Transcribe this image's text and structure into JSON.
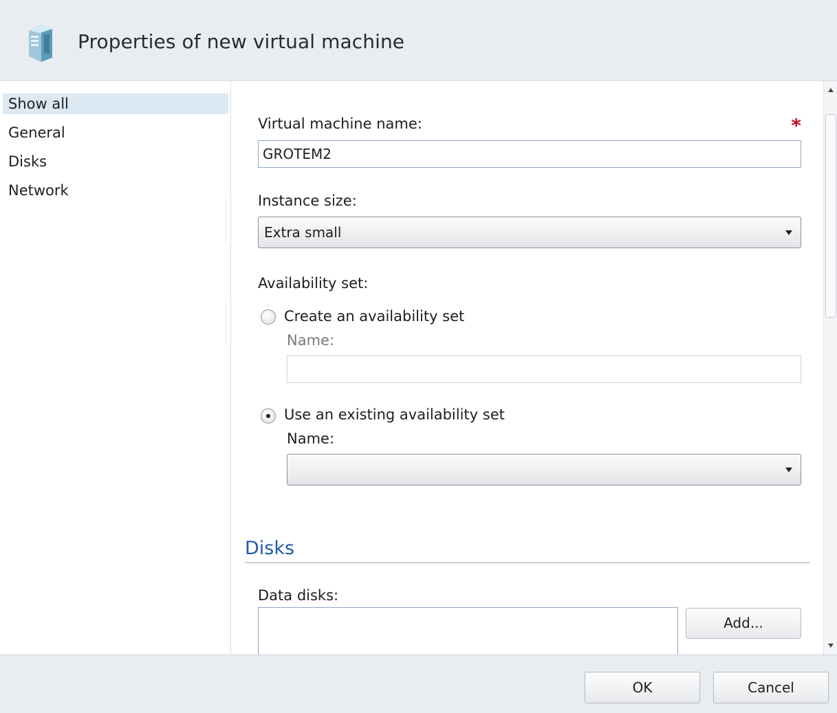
{
  "dialog": {
    "title": "Properties of new virtual machine",
    "icon": "server-tower-icon"
  },
  "nav": {
    "items": [
      {
        "label": "Show all",
        "selected": true
      },
      {
        "label": "General",
        "selected": false
      },
      {
        "label": "Disks",
        "selected": false
      },
      {
        "label": "Network",
        "selected": false
      }
    ]
  },
  "general": {
    "vm_name_label": "Virtual machine name:",
    "vm_name_required": "*",
    "vm_name_value": "GROTEM2",
    "instance_size_label": "Instance size:",
    "instance_size_value": "Extra small",
    "availability_set_label": "Availability set:",
    "create_option_label": "Create an availability set",
    "create_option_checked": false,
    "create_name_label": "Name:",
    "create_name_value": "",
    "existing_option_label": "Use an existing availability set",
    "existing_option_checked": true,
    "existing_name_label": "Name:",
    "existing_name_value": ""
  },
  "disks": {
    "section_title": "Disks",
    "data_disks_label": "Data disks:",
    "add_button": "Add..."
  },
  "footer": {
    "ok_button": "OK",
    "cancel_button": "Cancel"
  },
  "colors": {
    "header_bg": "#e9edf2",
    "nav_selected_bg": "#dce8f2",
    "section_title": "#1f5aa8",
    "required_star": "#c8102e"
  }
}
